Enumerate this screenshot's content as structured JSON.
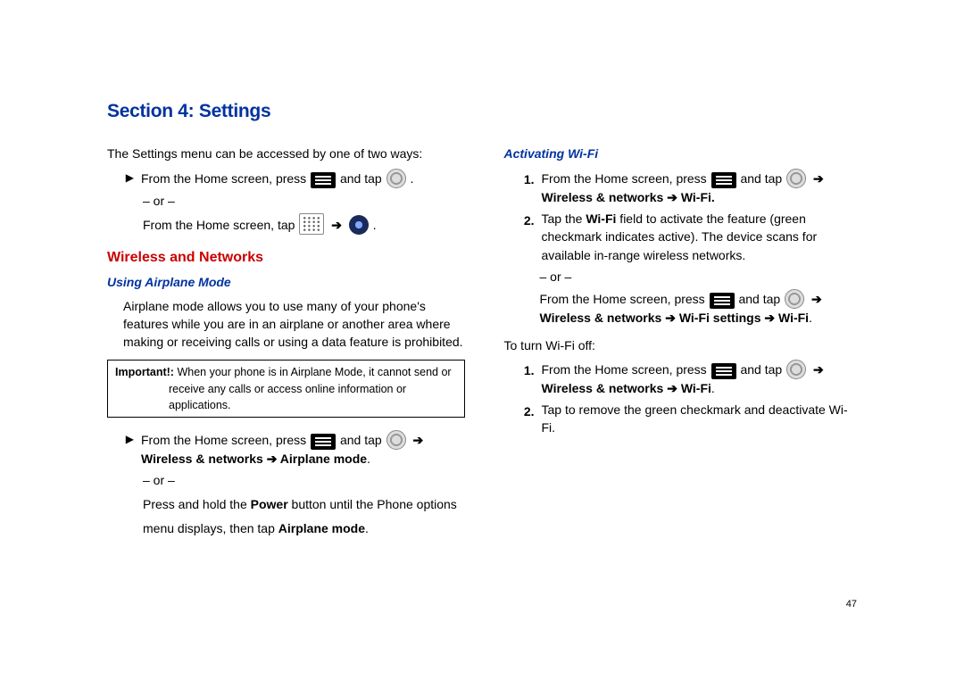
{
  "title": "Section 4: Settings",
  "page_number": "47",
  "left": {
    "intro": "The Settings menu can be accessed by one of two ways:",
    "l1_a": "From the Home screen, press ",
    "l1_b": " and tap ",
    "l1_c": ".",
    "or": "– or –",
    "l2_a": "From the Home screen, tap ",
    "l2_b": " .",
    "h2": "Wireless and Networks",
    "h3": "Using Airplane Mode",
    "para1": "Airplane mode allows you to use many of your phone's features while you are in an airplane or another area where making or receiving calls or using a data feature is prohibited.",
    "important_label": "Important!:",
    "important_text": " When your phone is in Airplane Mode, it cannot send or receive any calls or access online information or applications.",
    "s1_a": "From the Home screen, press ",
    "s1_b": " and tap ",
    "s1_bold": "Wireless & networks ➔ Airplane mode",
    "s1_dot": ".",
    "s1_or": "– or –",
    "s2_a": "Press and hold the ",
    "s2_power": "Power",
    "s2_b": " button until the Phone options menu displays, then tap ",
    "s2_ap": "Airplane mode",
    "s2_dot": "."
  },
  "right": {
    "h3": "Activating Wi-Fi",
    "r1_a": "From the Home screen, press ",
    "r1_b": " and tap ",
    "r1_bold": "Wireless & networks ➔ Wi-Fi.",
    "r2_a": "Tap the ",
    "r2_wifi": "Wi-Fi",
    "r2_b": " field to activate the feature (green checkmark indicates active). The device scans for available in-range wireless networks.",
    "r_or": "– or –",
    "r3_a": "From the Home screen, press ",
    "r3_b": " and tap ",
    "r3_bold": "Wireless & networks ➔ Wi-Fi settings ➔  Wi-Fi",
    "r3_dot": ".",
    "turn_off": "To turn Wi-Fi off:",
    "o1_a": "From the Home screen, press ",
    "o1_b": " and tap ",
    "o1_bold": "Wireless & networks ➔ Wi-Fi",
    "o1_dot": ".",
    "o2": "Tap to remove the green checkmark and deactivate Wi-Fi."
  },
  "markers": {
    "tri": "▶",
    "arr": "➔",
    "n1": "1.",
    "n2": "2."
  }
}
